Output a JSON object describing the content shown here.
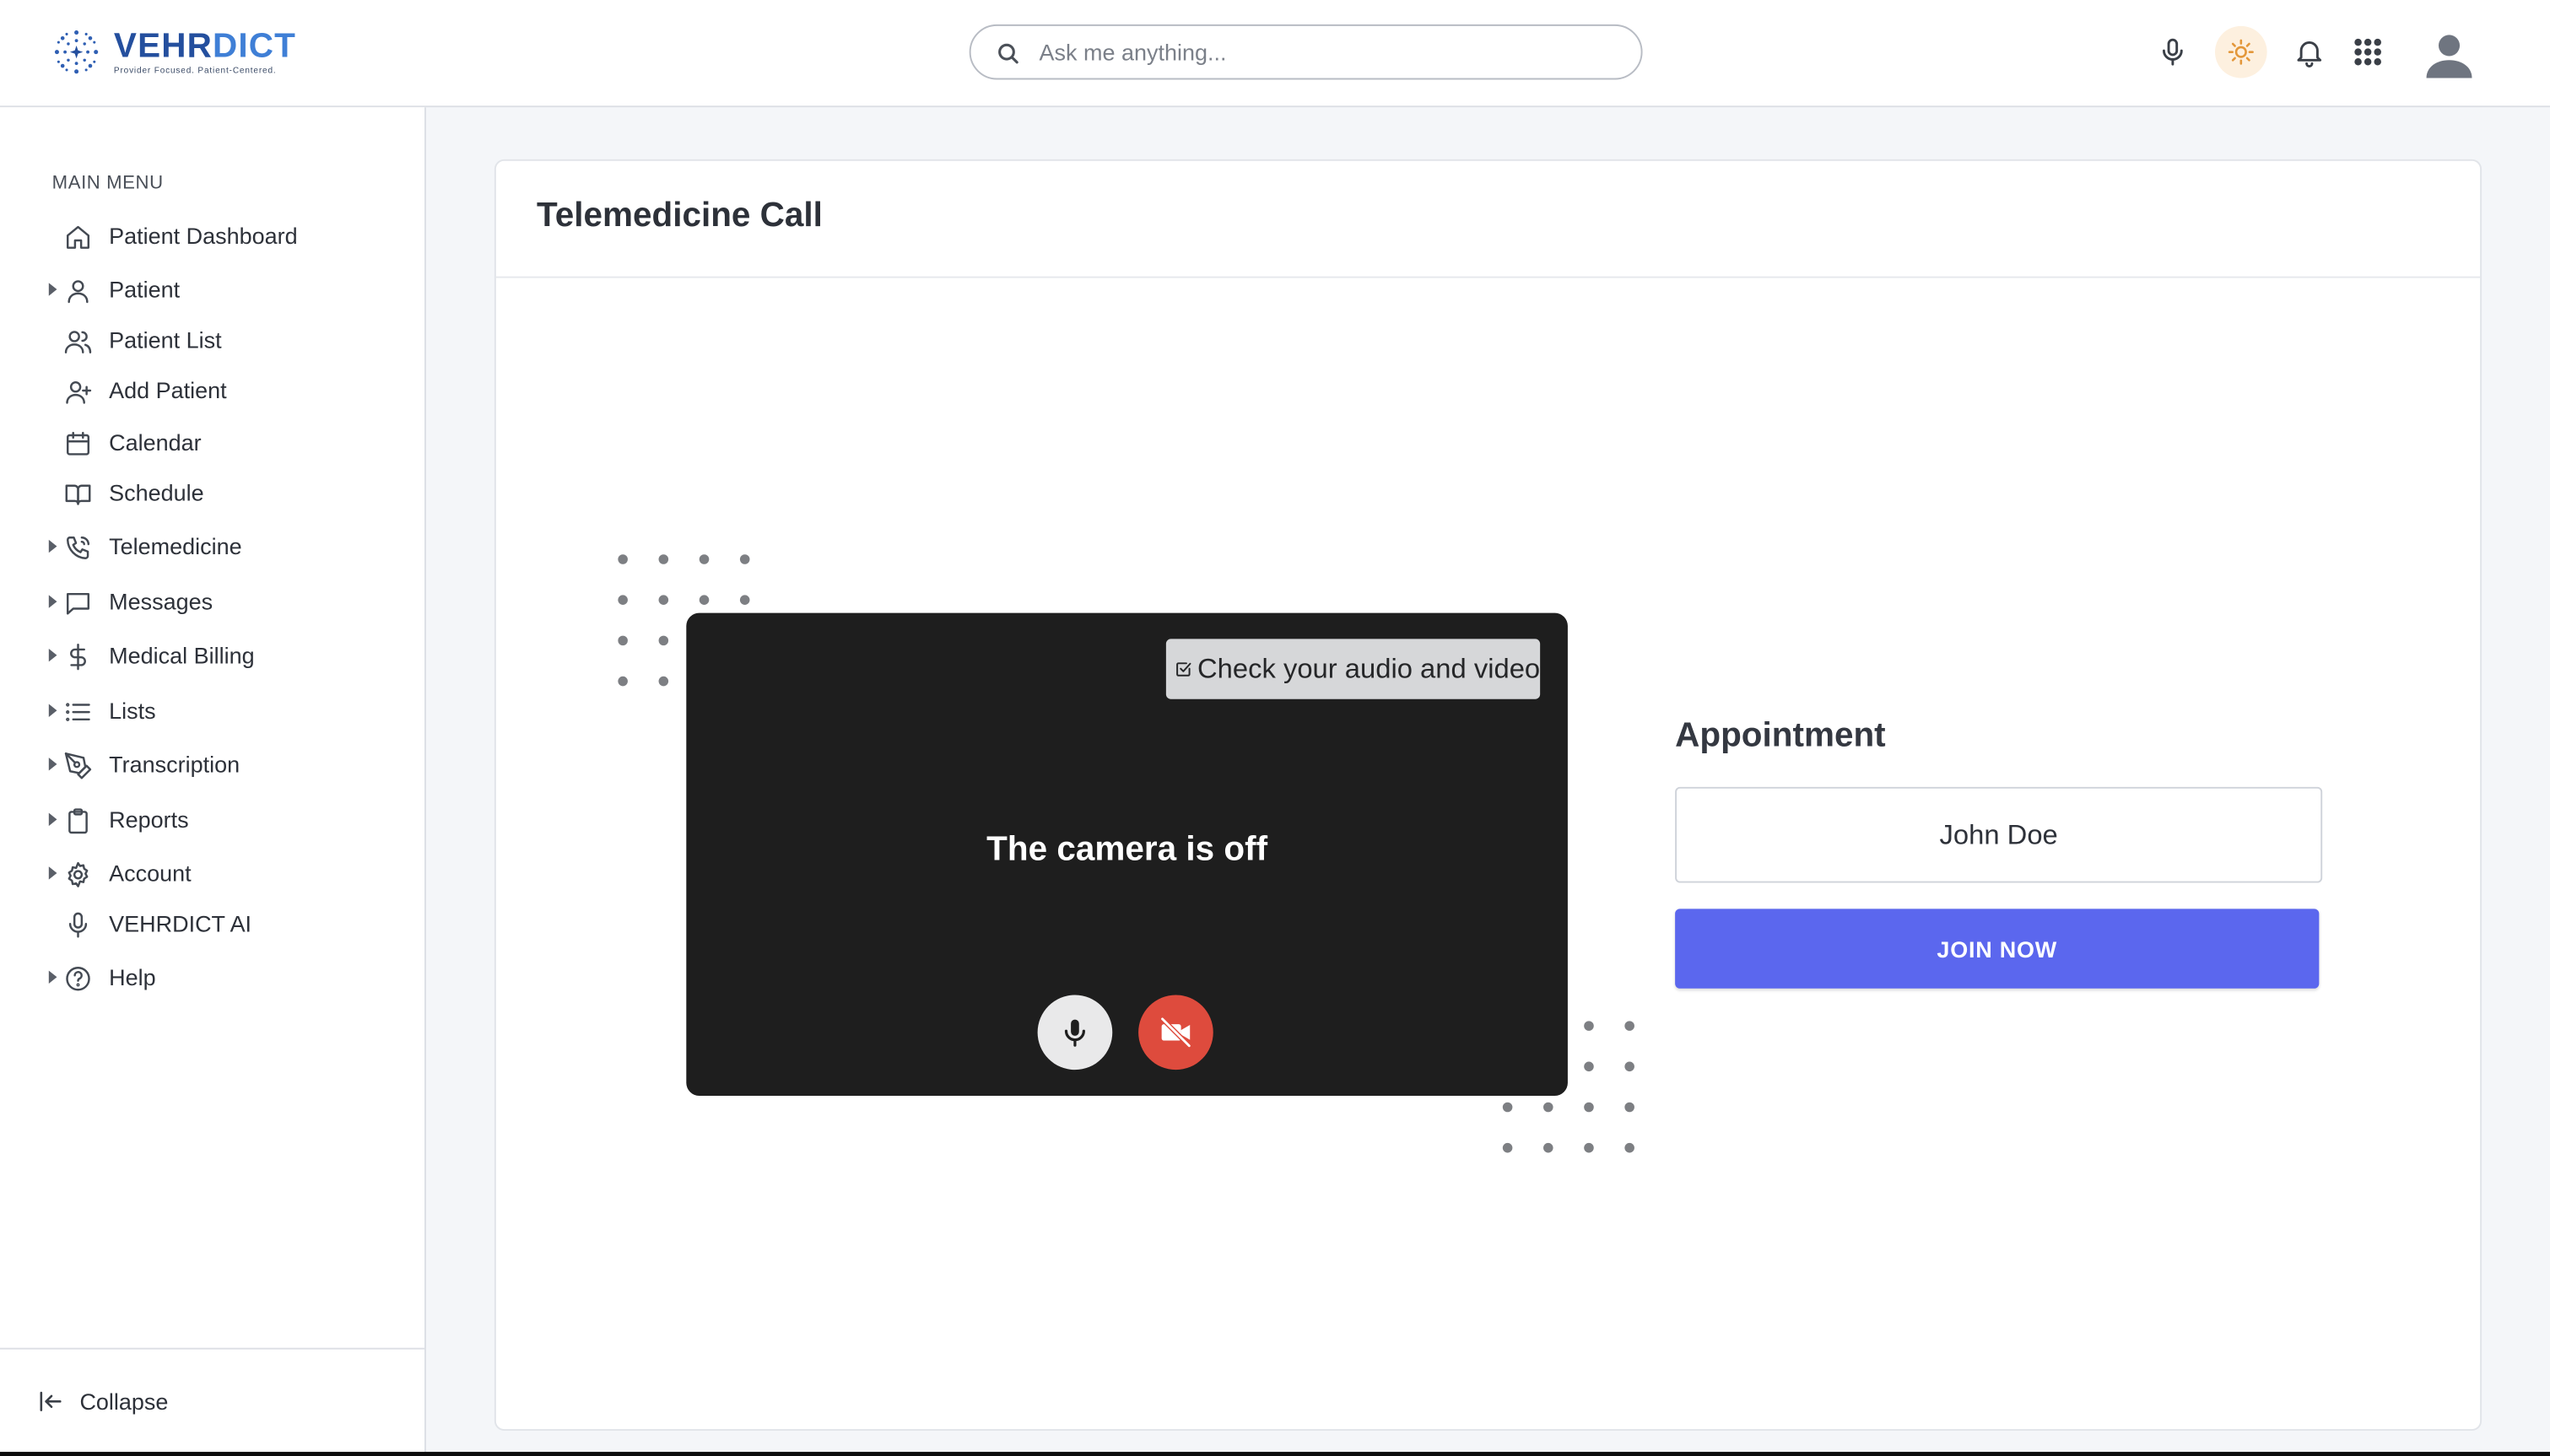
{
  "header": {
    "logo_word_a": "VEHR",
    "logo_word_b": "DICT",
    "logo_tagline": "Provider Focused. Patient-Centered.",
    "search_placeholder": "Ask me anything..."
  },
  "sidebar": {
    "menu_heading": "MAIN MENU",
    "items": [
      {
        "label": "Patient Dashboard",
        "icon": "home-icon"
      },
      {
        "label": "Patient",
        "icon": "user-icon",
        "expandable": true
      },
      {
        "label": "Patient List",
        "icon": "users-icon"
      },
      {
        "label": "Add Patient",
        "icon": "user-plus-icon"
      },
      {
        "label": "Calendar",
        "icon": "calendar-icon"
      },
      {
        "label": "Schedule",
        "icon": "book-icon"
      },
      {
        "label": "Telemedicine",
        "icon": "phone-icon",
        "expandable": true
      },
      {
        "label": "Messages",
        "icon": "message-icon",
        "expandable": true
      },
      {
        "label": "Medical Billing",
        "icon": "dollar-icon",
        "expandable": true
      },
      {
        "label": "Lists",
        "icon": "list-icon",
        "expandable": true
      },
      {
        "label": "Transcription",
        "icon": "pen-tool-icon",
        "expandable": true
      },
      {
        "label": "Reports",
        "icon": "clipboard-icon",
        "expandable": true
      },
      {
        "label": "Account",
        "icon": "gear-icon",
        "expandable": true
      },
      {
        "label": "VEHRDICT AI",
        "icon": "microphone-icon"
      },
      {
        "label": "Help",
        "icon": "help-circle-icon",
        "expandable": true
      }
    ],
    "collapse_label": "Collapse"
  },
  "main": {
    "card_title": "Telemedicine Call",
    "video": {
      "check_label": "Check your audio and video",
      "camera_status": "The camera is off"
    },
    "appointment": {
      "title": "Appointment",
      "patient_name": "John Doe",
      "join_label": "JOIN NOW"
    }
  },
  "colors": {
    "accent": "#5b67ee",
    "camera_off_red": "#de4b3d",
    "logo_dark_blue": "#244f9e",
    "logo_light_blue": "#3f7fd6"
  }
}
